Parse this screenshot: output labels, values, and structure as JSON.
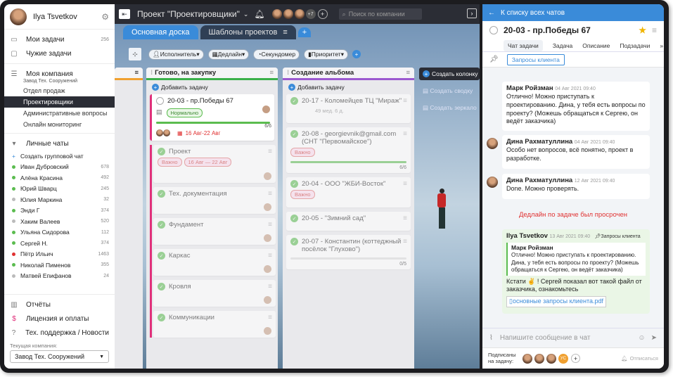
{
  "sidebar": {
    "user_name": "Ilya Tsvetkov",
    "my_tasks": {
      "label": "Мои задачи",
      "count": "256"
    },
    "other_tasks": "Чужие задачи",
    "company": {
      "label": "Моя компания",
      "sub": "Завод Тех. Сооружений"
    },
    "departments": [
      "Отдел продаж",
      "Проектировщики",
      "Административные вопросы",
      "Онлайн мониторинг"
    ],
    "active_department": "Проектировщики",
    "chats_header": "Личные чаты",
    "create_group": "Создать групповой чат",
    "chats": [
      {
        "name": "Иван Дубровский",
        "count": "678",
        "status": "#5bbc4f"
      },
      {
        "name": "Алёна Красина",
        "count": "492",
        "status": "#5bbc4f"
      },
      {
        "name": "Юрий Шварц",
        "count": "245",
        "status": "#5bbc4f"
      },
      {
        "name": "Юлия Маркина",
        "count": "32",
        "status": "#bbbbbb"
      },
      {
        "name": "Энди Г",
        "count": "374",
        "status": "#5bbc4f"
      },
      {
        "name": "Хаким Валеев",
        "count": "520",
        "status": "#bbbbbb"
      },
      {
        "name": "Ульяна Сидорова",
        "count": "112",
        "status": "#5bbc4f"
      },
      {
        "name": "Сергей Н.",
        "count": "374",
        "status": "#5bbc4f"
      },
      {
        "name": "Пётр Ильич",
        "count": "1463",
        "status": "#e03131"
      },
      {
        "name": "Николай Пименов",
        "count": "355",
        "status": "#5bbc4f"
      },
      {
        "name": "Матвей Епифанов",
        "count": "24",
        "status": "#bbbbbb"
      }
    ],
    "reports": "Отчёты",
    "license": "Лицензия и оплаты",
    "support": "Тех. поддержка / Новости",
    "current_company_label": "Текущая компания:",
    "current_company": "Завод Тех. Сооружений"
  },
  "board": {
    "project_title": "Проект \"Проектировщики\"",
    "avatar_more": "+7",
    "search_placeholder": "Поиск по компании",
    "tabs": [
      "Основная доска",
      "Шаблоны проектов"
    ],
    "filters": [
      "Исполнитель",
      "Дедлайн",
      "Секундомер",
      "Приоритет"
    ],
    "add_task": "Добавить задачу",
    "create_column": "Создать колонку",
    "create_swimlane": "Создать сводку",
    "create_mirror": "Создать зеркало",
    "columns": [
      {
        "title": "Готово, на закупку",
        "color": "#3ab04a",
        "main_card": {
          "title": "20-03 - пр.Победы 67",
          "tag": "Нормально",
          "progress": "6/6",
          "progress_value": 1.0,
          "deadline": "16 Авг-22 Авг"
        },
        "subcards": [
          {
            "title": "Проект",
            "tag": "Важно",
            "date": "16 Авг — 22 Авг"
          },
          {
            "title": "Тех. документация"
          },
          {
            "title": "Фундамент"
          },
          {
            "title": "Каркас"
          },
          {
            "title": "Кровля"
          },
          {
            "title": "Коммуникации"
          }
        ]
      },
      {
        "title": "Создание альбома",
        "color": "#9b59d0",
        "cards": [
          {
            "title": "20-17 - Коломейцев ТЦ \"Мираж\"",
            "meta": "49 мед. 6 д."
          },
          {
            "title": "20-08 - georgievnik@gmail.com (СНТ \"Первомайское\")",
            "tag": "Важно",
            "progress": "6/6",
            "progress_value": 1.0
          },
          {
            "title": "20-04 - ООО \"ЖБИ-Восток\"",
            "tag": "Важно"
          },
          {
            "title": "20-05 - \"Зимний сад\""
          },
          {
            "title": "20-07 - Константин (коттеджный посёлок \"Глухово\")",
            "progress": "0/5",
            "progress_value": 0
          }
        ]
      }
    ]
  },
  "chat": {
    "back_label": "К списку всех чатов",
    "task_title": "20-03 - пр.Победы 67",
    "tabs": [
      "Чат задачи",
      "Задача",
      "Описание",
      "Подзадачи"
    ],
    "active_tab": "Чат задачи",
    "pinned": "Запросы клиента",
    "messages": [
      {
        "author": "Марк Ройзман",
        "time": "04 Авг 2021 09:40",
        "text": "Отлично! Можно приступать к проектированию. Дина, у тебя есть вопросы по проекту? (Можешь обращаться к Сергею, он ведёт заказчика)"
      },
      {
        "author": "Дина Рахматуллина",
        "time": "04 Авг 2021 09:40",
        "text": "Особо нет вопросов, всё понятно, проект в разработке."
      },
      {
        "author": "Дина Рахматуллина",
        "time": "12 Авг 2021 09:40",
        "text": "Done. Можно проверять."
      }
    ],
    "overdue_notice": "Дедлайн по задаче был просрочен",
    "reply": {
      "author": "Ilya Tsvetkov",
      "time": "13 Авг 2021 09:40",
      "pin_label": "Запросы клиента",
      "quote_author": "Марк Ройзман",
      "quote_text": "Отлично! Можно приступать к проектированию. Дина, у тебя есть вопросы по проекту? (Можешь обращаться к Сергею, он ведёт заказчика)",
      "text": "Кстати ✌ ! Сергей показал вот такой файл от заказчика, ознакомьтесь",
      "file": "основные запросы клиента.pdf"
    },
    "input_placeholder": "Напишите сообщение в чат",
    "subscribed_label": "Подписаны на задачу:",
    "unsubscribe": "Отписаться",
    "sub_initials": "УС"
  }
}
